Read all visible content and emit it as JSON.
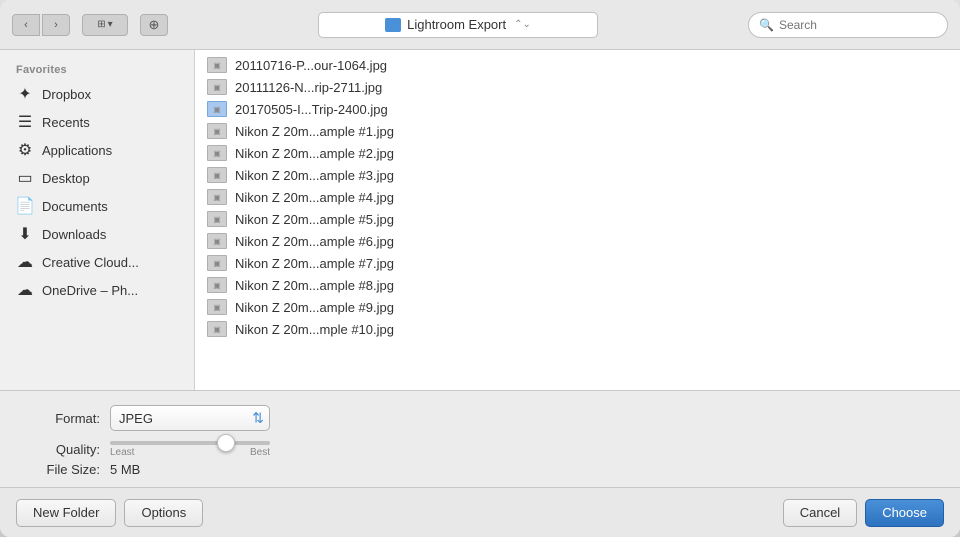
{
  "toolbar": {
    "back_label": "‹",
    "forward_label": "›",
    "view_label": "⊞▾",
    "new_folder_icon": "⊕",
    "location": "Lightroom Export",
    "search_placeholder": "Search"
  },
  "sidebar": {
    "section_title": "Favorites",
    "items": [
      {
        "id": "dropbox",
        "label": "Dropbox",
        "icon": "✦"
      },
      {
        "id": "recents",
        "label": "Recents",
        "icon": "☰"
      },
      {
        "id": "applications",
        "label": "Applications",
        "icon": "⚙"
      },
      {
        "id": "desktop",
        "label": "Desktop",
        "icon": "▭"
      },
      {
        "id": "documents",
        "label": "Documents",
        "icon": "📄"
      },
      {
        "id": "downloads",
        "label": "Downloads",
        "icon": "⬇"
      },
      {
        "id": "creative-cloud",
        "label": "Creative Cloud...",
        "icon": "☁"
      },
      {
        "id": "onedrive",
        "label": "OneDrive – Ph...",
        "icon": "☁"
      }
    ]
  },
  "files": [
    {
      "name": "20110716-P...our-1064.jpg",
      "type": "img"
    },
    {
      "name": "20111126-N...rip-2711.jpg",
      "type": "img"
    },
    {
      "name": "20170505-I...Trip-2400.jpg",
      "type": "blue"
    },
    {
      "name": "Nikon Z 20m...ample #1.jpg",
      "type": "img"
    },
    {
      "name": "Nikon Z 20m...ample #2.jpg",
      "type": "img"
    },
    {
      "name": "Nikon Z 20m...ample #3.jpg",
      "type": "img"
    },
    {
      "name": "Nikon Z 20m...ample #4.jpg",
      "type": "img"
    },
    {
      "name": "Nikon Z 20m...ample #5.jpg",
      "type": "img"
    },
    {
      "name": "Nikon Z 20m...ample #6.jpg",
      "type": "img"
    },
    {
      "name": "Nikon Z 20m...ample #7.jpg",
      "type": "img"
    },
    {
      "name": "Nikon Z 20m...ample #8.jpg",
      "type": "img"
    },
    {
      "name": "Nikon Z 20m...ample #9.jpg",
      "type": "img"
    },
    {
      "name": "Nikon Z 20m...mple #10.jpg",
      "type": "img"
    }
  ],
  "options": {
    "format_label": "Format:",
    "format_value": "JPEG",
    "quality_label": "Quality:",
    "slider_min_label": "Least",
    "slider_max_label": "Best",
    "slider_value": 75,
    "filesize_label": "File Size:",
    "filesize_value": "5 MB"
  },
  "buttons": {
    "new_folder": "New Folder",
    "options": "Options",
    "cancel": "Cancel",
    "choose": "Choose"
  }
}
